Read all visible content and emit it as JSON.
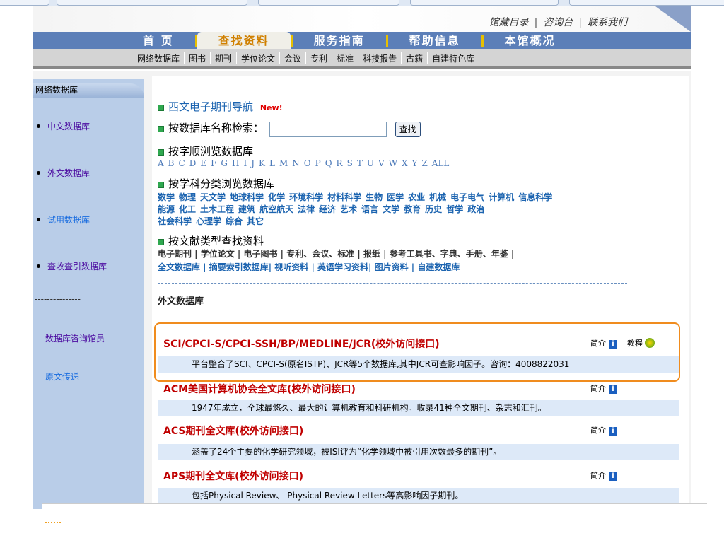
{
  "header": {
    "top_links": [
      "馆藏目录",
      "咨询台",
      "联系我们"
    ]
  },
  "main_nav": [
    {
      "label": "首 页"
    },
    {
      "label": "查找资料",
      "active": true
    },
    {
      "label": "服务指南"
    },
    {
      "label": "帮助信息"
    },
    {
      "label": "本馆概况"
    }
  ],
  "sub_nav": [
    "网络数据库",
    "图书",
    "期刊",
    "学位论文",
    "会议",
    "专利",
    "标准",
    "科技报告",
    "古籍",
    "自建特色库"
  ],
  "sidebar": {
    "heading": "网络数据库",
    "items": [
      "中文数据库",
      "外文数据库",
      "试用数据库",
      "查收查引数据库"
    ],
    "divider": "---------------",
    "extra": [
      "数据库咨询馆员",
      "原文传递"
    ]
  },
  "content": {
    "ejournal_nav": "西文电子期刊导航",
    "new_badge": "New!",
    "search_label": "按数据库名称检索：",
    "search_value": "",
    "search_button": "查找",
    "alpha_label": "按字顺浏览数据库",
    "letters": [
      "A",
      "B",
      "C",
      "D",
      "E",
      "F",
      "G",
      "H",
      "I",
      "J",
      "K",
      "L",
      "M",
      "N",
      "O",
      "P",
      "Q",
      "R",
      "S",
      "T",
      "U",
      "V",
      "W",
      "X",
      "Y",
      "Z",
      "ALL"
    ],
    "subject_label": "按学科分类浏览数据库",
    "subjects": [
      [
        "数学",
        "物理",
        "天文学",
        "地球科学",
        "化学",
        "环境科学",
        "材料科学",
        "生物",
        "医学",
        "农业",
        "机械",
        "电子电气",
        "计算机",
        "信息科学"
      ],
      [
        "能源",
        "化工",
        "土木工程",
        "建筑",
        "航空航天",
        "法律",
        "经济",
        "艺术",
        "语言",
        "文学",
        "教育",
        "历史",
        "哲学",
        "政治"
      ],
      [
        "社会科学",
        "心理学",
        "综合",
        "其它"
      ]
    ],
    "type_label": "按文献类型查找资料",
    "types_row1": "电子期刊 | 学位论文 | 电子图书 | 专利、会议、标准 | 报纸 | 参考工具书、字典、手册、年鉴 |",
    "types_row2": "全文数据库 | 摘要索引数据库| 视听资料 | 英语学习资料| 图片资料 | 自建数据库",
    "section_title": "外文数据库",
    "intro_label": "简介",
    "tutorial_label": "教程",
    "databases": [
      {
        "title": "SCI/CPCI-S/CPCI-SSH/BP/MEDLINE/JCR(校外访问接口)",
        "desc": "平台整合了SCI、CPCI-S(原名ISTP)、JCR等5个数据库,其中JCR可查影响因子。咨询：4008822031",
        "highlighted": true
      },
      {
        "title": "ACM美国计算机协会全文库(校外访问接口)",
        "desc": "1947年成立，全球最悠久、最大的计算机教育和科研机构。收录41种全文期刊、杂志和汇刊。"
      },
      {
        "title": "ACS期刊全文库(校外访问接口)",
        "desc": "涵盖了24个主要的化学研究领域，被ISI评为“化学领域中被引用次数最多的期刊”。"
      },
      {
        "title": "APS期刊全文库(校外访问接口)",
        "desc": "包括Physical Review、 Physical Review Letters等高影响因子期刊。"
      }
    ]
  },
  "colors": {
    "nav_blue": "#5c7fb8",
    "sidebar": "#b9cde8",
    "highlight": "#f08c1e",
    "title_red": "#c00000"
  }
}
